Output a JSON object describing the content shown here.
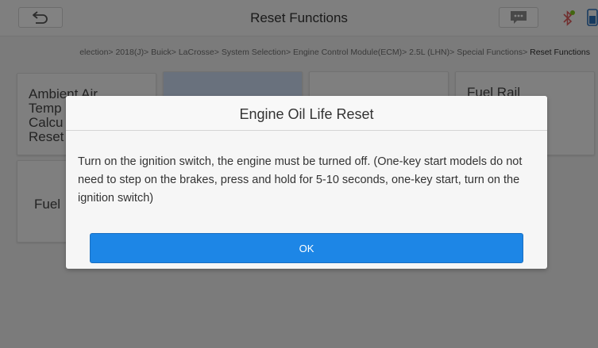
{
  "header": {
    "title": "Reset Functions",
    "back_icon": "back-arrow-icon",
    "message_icon": "message-icon",
    "bluetooth_icon": "bluetooth-icon",
    "battery_icon": "battery-icon"
  },
  "breadcrumb": {
    "path": "election> 2018(J)> Buick> LaCrosse> System Selection> Engine Control Module(ECM)> 2.5L (LHN)> Special Functions> ",
    "current": "Reset Functions"
  },
  "tiles": [
    {
      "label": "Ambient Air\nTemp\nCalcu\nReset"
    },
    {
      "label": ""
    },
    {
      "label": ""
    },
    {
      "label": "Fuel Rail\n              lief\n              ed\n              t"
    },
    {
      "label": "Fuel"
    }
  ],
  "dialog": {
    "title": "Engine Oil Life Reset",
    "message": "Turn on the ignition switch, the engine must be turned off. (One-key start models do not need to step on the brakes, press and hold for 5-10 seconds, one-key start, turn on the ignition switch)",
    "ok_label": "OK"
  },
  "colors": {
    "accent": "#1d86e6",
    "header_bg": "#f4f4f4",
    "overlay": "rgba(0,0,0,0.48)",
    "bluetooth_green": "#7fc31e"
  }
}
